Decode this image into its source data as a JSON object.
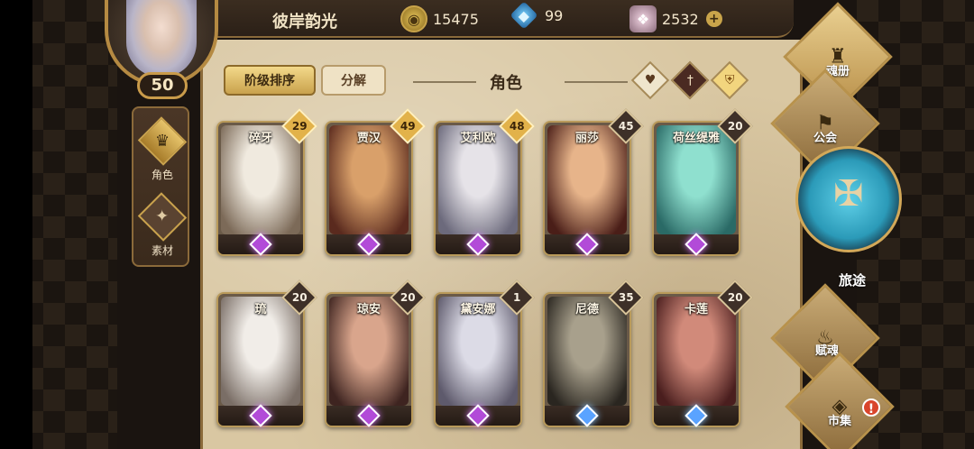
{
  "player": {
    "name": "彼岸韵光",
    "level": "50"
  },
  "resources": [
    {
      "icon": "gold-coin-icon",
      "value": "15475"
    },
    {
      "icon": "blue-gem-icon",
      "value": "99"
    },
    {
      "icon": "crystal-icon",
      "value": "2532"
    }
  ],
  "left_rail": {
    "items": [
      {
        "label": "角色",
        "icon": "character-icon",
        "active": true
      },
      {
        "label": "素材",
        "icon": "material-icon",
        "active": false
      }
    ]
  },
  "panel": {
    "title": "角色",
    "sort_button": "阶级排序",
    "decompose_button": "分解"
  },
  "filters": [
    {
      "icon": "heart-icon"
    },
    {
      "icon": "sword-icon"
    },
    {
      "icon": "shield-icon"
    }
  ],
  "heroes": [
    {
      "name": "碎牙",
      "level": "29",
      "level_style": "gold",
      "rank": "purple",
      "tint1": "#f0eadf",
      "tint2": "#7c6a58"
    },
    {
      "name": "贾汉",
      "level": "49",
      "level_style": "gold",
      "rank": "purple",
      "tint1": "#d9a06a",
      "tint2": "#5a2a1e"
    },
    {
      "name": "艾利欧",
      "level": "48",
      "level_style": "gold",
      "rank": "purple",
      "tint1": "#e6e3e8",
      "tint2": "#6c6a7c"
    },
    {
      "name": "丽莎",
      "level": "45",
      "level_style": "dark",
      "rank": "purple",
      "tint1": "#e7b48a",
      "tint2": "#4a1e18"
    },
    {
      "name": "荷丝缇雅",
      "level": "20",
      "level_style": "dark",
      "rank": "purple",
      "tint1": "#8fe0cf",
      "tint2": "#2a6a66"
    },
    {
      "name": "琉",
      "level": "20",
      "level_style": "dark",
      "rank": "purple",
      "tint1": "#f1ede8",
      "tint2": "#7a6e66"
    },
    {
      "name": "琼安",
      "level": "20",
      "level_style": "dark",
      "rank": "purple",
      "tint1": "#d9a58c",
      "tint2": "#3e2420"
    },
    {
      "name": "黛安娜",
      "level": "1",
      "level_style": "dark",
      "rank": "purple",
      "tint1": "#dcdbe6",
      "tint2": "#5e5a6c"
    },
    {
      "name": "尼德",
      "level": "35",
      "level_style": "dark",
      "rank": "blue",
      "tint1": "#a8a08c",
      "tint2": "#2a2620"
    },
    {
      "name": "卡莲",
      "level": "20",
      "level_style": "dark",
      "rank": "blue",
      "tint1": "#d18a7a",
      "tint2": "#4a1e1e"
    }
  ],
  "right_nav": {
    "soul_book": "魂册",
    "guild": "公会",
    "journey": "旅途",
    "soul_gift": "赋魂",
    "market": "市集",
    "market_alert": "!"
  },
  "colors": {
    "parchment": "#d9c7a2",
    "gold_accent": "#c9a24d",
    "rank_purple": "#b24bd8",
    "rank_blue": "#5aa3ff"
  }
}
